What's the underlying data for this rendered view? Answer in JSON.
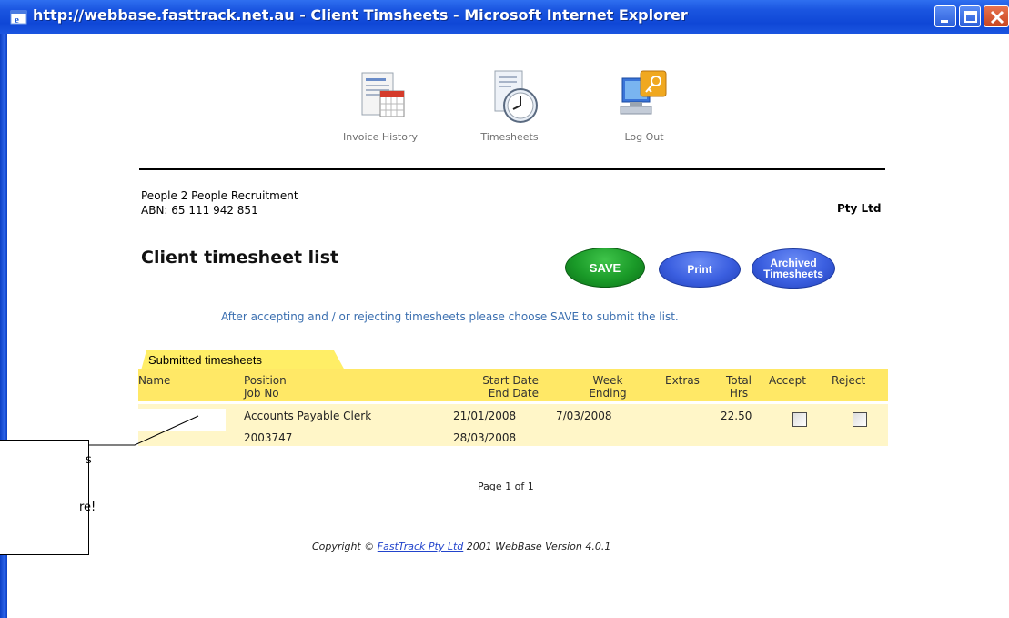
{
  "window": {
    "title": "http://webbase.fasttrack.net.au - Client Timsheets - Microsoft Internet Explorer"
  },
  "nav": {
    "items": [
      {
        "label": "Invoice History",
        "icon": "invoice-history-icon"
      },
      {
        "label": "Timesheets",
        "icon": "timesheets-icon"
      },
      {
        "label": "Log Out",
        "icon": "log-out-icon"
      }
    ]
  },
  "company": {
    "name": "People 2 People Recruitment",
    "abn": "ABN: 65 111 942 851",
    "suffix": "Pty Ltd"
  },
  "page": {
    "heading": "Client timesheet list",
    "instruction": "After accepting and / or rejecting timesheets please choose SAVE to submit the list.",
    "page_info": "Page 1 of 1"
  },
  "buttons": {
    "save": "SAVE",
    "print": "Print",
    "archived_line1": "Archived",
    "archived_line2": "Timesheets"
  },
  "table": {
    "tab": "Submitted timesheets",
    "headers": {
      "name": "Name",
      "position": "Position",
      "job_no": "Job No",
      "start_date": "Start Date",
      "end_date": "End Date",
      "week": "Week",
      "ending": "Ending",
      "extras": "Extras",
      "total": "Total",
      "hrs": "Hrs",
      "accept": "Accept",
      "reject": "Reject"
    },
    "rows": [
      {
        "name": "",
        "position": "Accounts Payable Clerk",
        "job_no": "2003747",
        "start_date": "21/01/2008",
        "end_date": "28/03/2008",
        "week_ending": "7/03/2008",
        "extras": "",
        "total_hrs": "22.50",
        "accepted": false,
        "rejected": false
      }
    ]
  },
  "footer": {
    "copyright_prefix": "Copyright ©",
    "link": "FastTrack Pty Ltd",
    "copyright_suffix": "2001   WebBase Version 4.0.1"
  },
  "callout": {
    "line1": "s",
    "line2": "re!"
  },
  "colors": {
    "titlebar": "#1a55e0",
    "tab": "#ffee66",
    "header_row": "#ffe866",
    "data_row": "#fff6c8",
    "save_button": "#1a9a28",
    "blue_button": "#3b5fe0",
    "instruction_text": "#3b6fb0"
  }
}
